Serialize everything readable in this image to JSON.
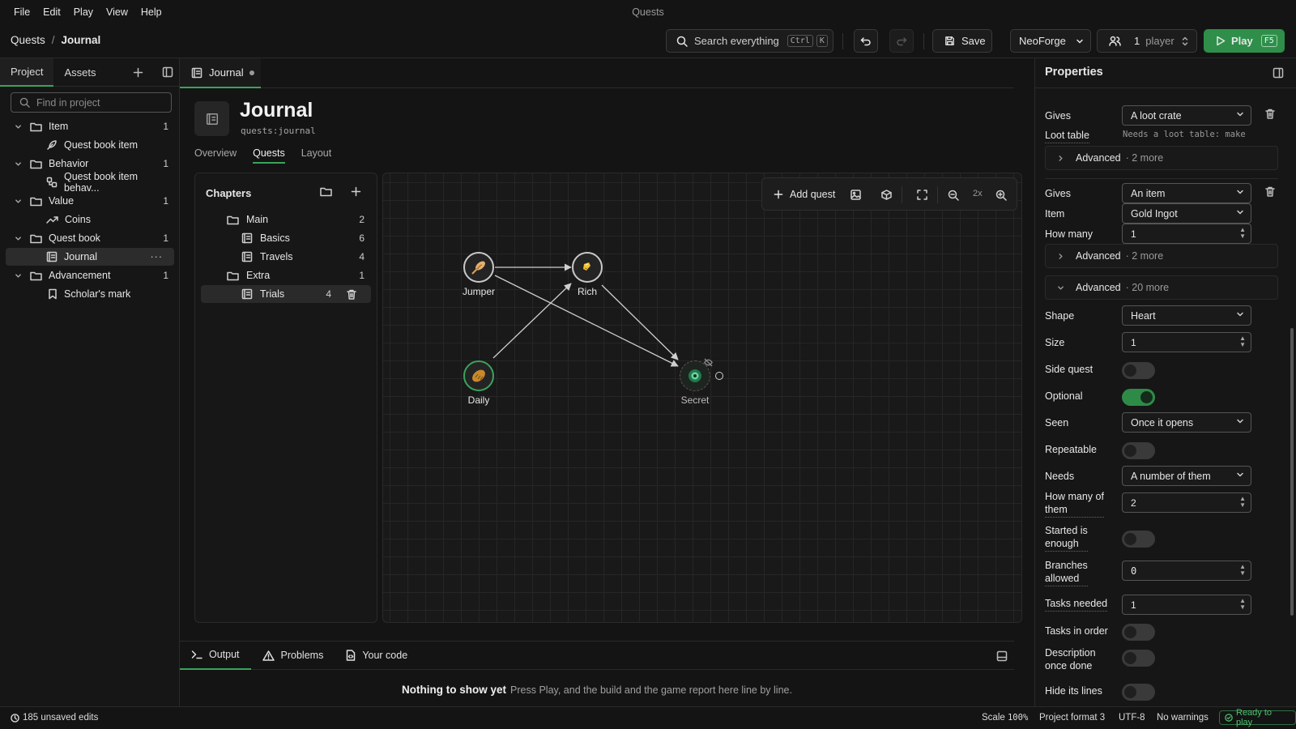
{
  "app": {
    "title": "Quests"
  },
  "menu": [
    "File",
    "Edit",
    "Play",
    "View",
    "Help"
  ],
  "breadcrumb": {
    "root": "Quests",
    "separator": "/",
    "current": "Journal"
  },
  "toolbar": {
    "search_label": "Search everything",
    "search_kbd1": "Ctrl",
    "search_kbd2": "K",
    "save_label": "Save",
    "loader": "NeoForge",
    "players_value": "1",
    "players_unit": "player",
    "play_label": "Play",
    "play_kbd": "F5",
    "play_color": "#2f8f4a"
  },
  "left_panel": {
    "tabs": [
      "Project",
      "Assets"
    ],
    "search_placeholder": "Find in project",
    "tree": [
      {
        "label": "Item",
        "count": "1"
      },
      {
        "label": "Quest book item"
      },
      {
        "label": "Behavior",
        "count": "1"
      },
      {
        "label": "Quest book item behav..."
      },
      {
        "label": "Value",
        "count": "1"
      },
      {
        "label": "Coins"
      },
      {
        "label": "Quest book",
        "count": "1"
      },
      {
        "label": "Journal"
      },
      {
        "label": "Advancement",
        "count": "1"
      },
      {
        "label": "Scholar's mark"
      }
    ]
  },
  "editor": {
    "tab_label": "Journal",
    "title": "Journal",
    "id": "quests:journal",
    "tabs": [
      "Overview",
      "Quests",
      "Layout"
    ]
  },
  "chapters": {
    "title": "Chapters",
    "items": [
      {
        "label": "Main",
        "count": "2"
      },
      {
        "label": "Basics",
        "count": "6"
      },
      {
        "label": "Travels",
        "count": "4"
      },
      {
        "label": "Extra",
        "count": "1"
      },
      {
        "label": "Trials",
        "count": "4"
      }
    ]
  },
  "canvas": {
    "add_quest": "Add quest",
    "zoom": "2x",
    "quests": [
      {
        "label": "Jumper",
        "icon": "feather-icon"
      },
      {
        "label": "Rich",
        "icon": "gold-icon"
      },
      {
        "label": "Daily",
        "icon": "bread-icon"
      },
      {
        "label": "Secret",
        "icon": "ender-eye-icon"
      }
    ]
  },
  "bottom_panel": {
    "tabs": [
      "Output",
      "Problems",
      "Your code"
    ],
    "empty_title": "Nothing to show yet",
    "empty_text": "Press Play, and the build and the game report here line by line."
  },
  "properties": {
    "title": "Properties",
    "reward1": {
      "gives_label": "Gives",
      "gives_value": "A loot crate",
      "loot_label": "Loot table",
      "loot_hint": "Needs a loot table: make"
    },
    "adv1": {
      "label": "Advanced",
      "more": "· 2 more"
    },
    "reward2": {
      "gives_label": "Gives",
      "gives_value": "An item",
      "item_label": "Item",
      "item_value": "Gold Ingot",
      "howmany_label": "How many",
      "howmany_value": "1"
    },
    "adv2": {
      "label": "Advanced",
      "more": "· 2 more"
    },
    "adv3": {
      "label": "Advanced",
      "more": "· 20 more"
    },
    "fields": {
      "shape_label": "Shape",
      "shape_value": "Heart",
      "size_label": "Size",
      "size_value": "1",
      "side_label": "Side quest",
      "optional_label": "Optional",
      "seen_label": "Seen",
      "seen_value": "Once it opens",
      "repeatable_label": "Repeatable",
      "needs_label": "Needs",
      "needs_value": "A number of them",
      "howmanyof_label1": "How many of",
      "howmanyof_label2": "them",
      "howmanyof_value": "2",
      "started_label1": "Started is",
      "started_label2": "enough",
      "branches_label1": "Branches",
      "branches_label2": "allowed",
      "branches_value": "0",
      "tasks_needed_label": "Tasks needed",
      "tasks_needed_value": "1",
      "tasks_order_label": "Tasks in order",
      "desc_label1": "Description",
      "desc_label2": "once done",
      "hide_label": "Hide its lines"
    },
    "toggles": {
      "side_quest": false,
      "optional": true,
      "repeatable": false,
      "started_enough": false,
      "tasks_in_order": false,
      "description_once_done": false,
      "hide_lines": false
    }
  },
  "status": {
    "unsaved": "185 unsaved edits",
    "scale_label": "Scale",
    "scale_value": "100%",
    "format": "Project format 3",
    "encoding": "UTF-8",
    "warnings": "No warnings",
    "ready": "Ready to play"
  },
  "colors": {
    "accent": "#3aa35c",
    "background": "#141414"
  }
}
